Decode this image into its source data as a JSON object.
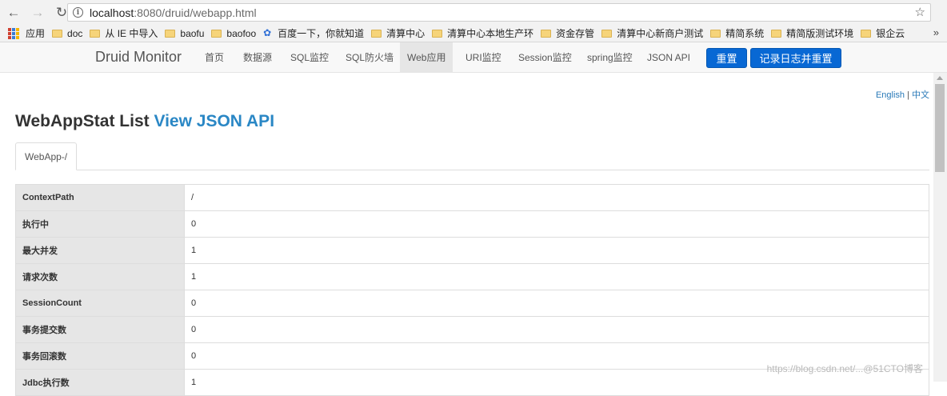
{
  "browser": {
    "url_host": "localhost",
    "url_rest": ":8080/druid/webapp.html",
    "bookmarks": [
      {
        "label": "应用",
        "icon": "apps-icon"
      },
      {
        "label": "doc",
        "icon": "folder-icon"
      },
      {
        "label": "从 IE 中导入",
        "icon": "folder-icon"
      },
      {
        "label": "baofu",
        "icon": "folder-icon"
      },
      {
        "label": "baofoo",
        "icon": "folder-icon"
      },
      {
        "label": "百度一下，你就知道",
        "icon": "paw-icon"
      },
      {
        "label": "清算中心",
        "icon": "folder-icon"
      },
      {
        "label": "清算中心本地生产环",
        "icon": "folder-icon"
      },
      {
        "label": "资金存管",
        "icon": "folder-icon"
      },
      {
        "label": "清算中心新商户测试",
        "icon": "folder-icon"
      },
      {
        "label": "精简系统",
        "icon": "folder-icon"
      },
      {
        "label": "精简版测试环境",
        "icon": "folder-icon"
      },
      {
        "label": "银企云",
        "icon": "folder-icon"
      }
    ],
    "more": "»"
  },
  "navbar": {
    "brand": "Druid Monitor",
    "items": [
      "首页",
      "数据源",
      "SQL监控",
      "SQL防火墙",
      "Web应用",
      "URI监控",
      "Session监控",
      "spring监控",
      "JSON API"
    ],
    "active_index": 4,
    "reset_button": "重置",
    "log_reset_button": "记录日志并重置"
  },
  "lang": {
    "english": "English",
    "separator": " | ",
    "chinese": "中文"
  },
  "page": {
    "title": "WebAppStat List",
    "json_link": "View JSON API"
  },
  "tabs": [
    "WebApp-/"
  ],
  "stats": [
    {
      "key": "ContextPath",
      "value": "/"
    },
    {
      "key": "执行中",
      "value": "0"
    },
    {
      "key": "最大并发",
      "value": "1"
    },
    {
      "key": "请求次数",
      "value": "1"
    },
    {
      "key": "SessionCount",
      "value": "0"
    },
    {
      "key": "事务提交数",
      "value": "0"
    },
    {
      "key": "事务回滚数",
      "value": "0"
    },
    {
      "key": "Jdbc执行数",
      "value": "1"
    }
  ],
  "watermark": "https://blog.csdn.net/...@51CTO博客"
}
